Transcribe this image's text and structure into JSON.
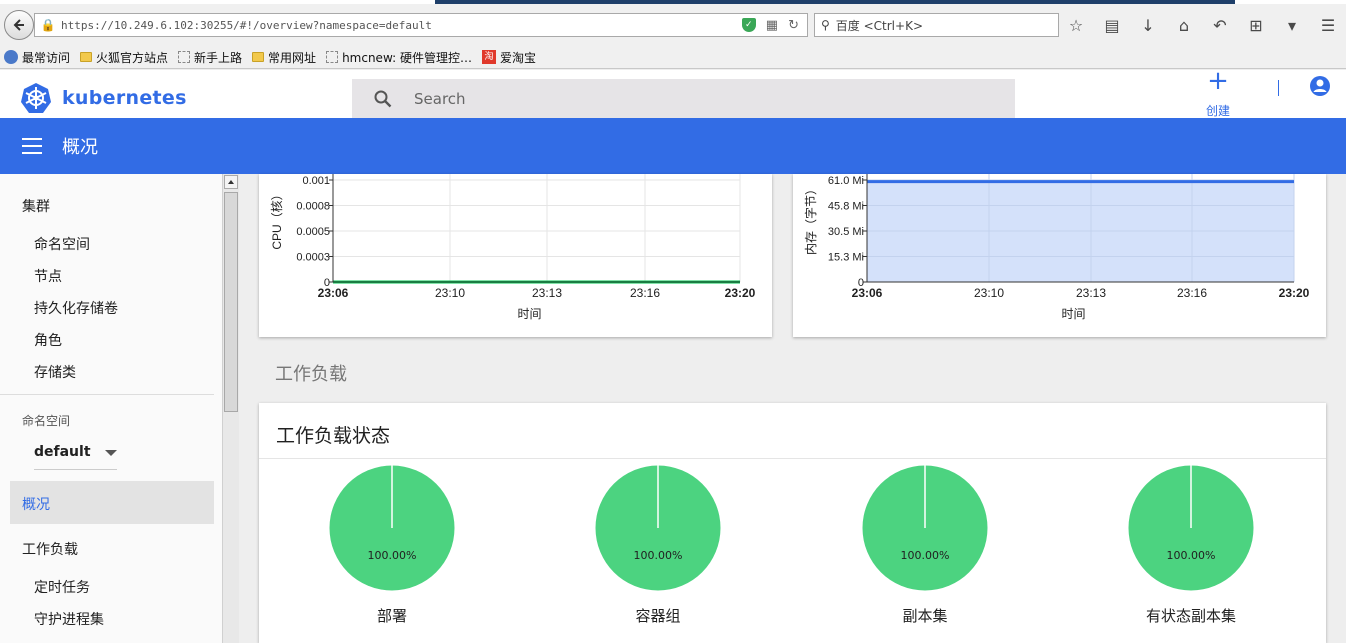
{
  "browser": {
    "url": "https://10.249.6.102:30255/#!/overview?namespace=default",
    "search_placeholder": "百度 <Ctrl+K>",
    "bookmarks": [
      "最常访问",
      "火狐官方站点",
      "新手上路",
      "常用网址",
      "hmcnew: 硬件管理控…",
      "爱淘宝"
    ]
  },
  "header": {
    "logo_text": "kubernetes",
    "search_placeholder": "Search",
    "create_label": "创建"
  },
  "titlebar": {
    "title": "概况"
  },
  "sidebar": {
    "cluster_heading": "集群",
    "cluster_items": [
      "命名空间",
      "节点",
      "持久化存储卷",
      "角色",
      "存储类"
    ],
    "namespace_label": "命名空间",
    "namespace_value": "default",
    "active_item": "概况",
    "workloads_heading": "工作负载",
    "workload_items": [
      "定时任务",
      "守护进程集"
    ]
  },
  "colors": {
    "brand": "#326ce5",
    "pie_green": "#4cd380",
    "cpu_line": "#00c752",
    "mem_fill": "#d4e1fa",
    "mem_line": "#326ce5"
  },
  "chart_data": [
    {
      "type": "line",
      "xlabel": "时间",
      "ylabel": "CPU（核）",
      "x_ticks": [
        "23:06",
        "23:10",
        "23:13",
        "23:16",
        "23:20"
      ],
      "y_ticks": [
        "0",
        "0.0003",
        "0.0005",
        "0.0008",
        "0.001"
      ],
      "ylim": [
        0,
        0.001
      ],
      "series": [
        {
          "values": [
            0,
            0,
            0,
            0,
            0
          ]
        }
      ],
      "grid": true
    },
    {
      "type": "area",
      "xlabel": "时间",
      "ylabel": "内存（字节）",
      "x_ticks": [
        "23:06",
        "23:10",
        "23:13",
        "23:16",
        "23:20"
      ],
      "y_ticks": [
        "0",
        "15.3 Mi",
        "30.5 Mi",
        "45.8 Mi",
        "61.0 Mi"
      ],
      "ylim": [
        0,
        61.0
      ],
      "series": [
        {
          "values": [
            60,
            60,
            60,
            60,
            60
          ]
        }
      ],
      "grid": true
    }
  ],
  "workload_section_title": "工作负载",
  "workload_status": {
    "title": "工作负载状态",
    "pies": [
      {
        "name": "部署",
        "percent": 100,
        "label": "100.00%"
      },
      {
        "name": "容器组",
        "percent": 100,
        "label": "100.00%"
      },
      {
        "name": "副本集",
        "percent": 100,
        "label": "100.00%"
      },
      {
        "name": "有状态副本集",
        "percent": 100,
        "label": "100.00%"
      }
    ]
  }
}
